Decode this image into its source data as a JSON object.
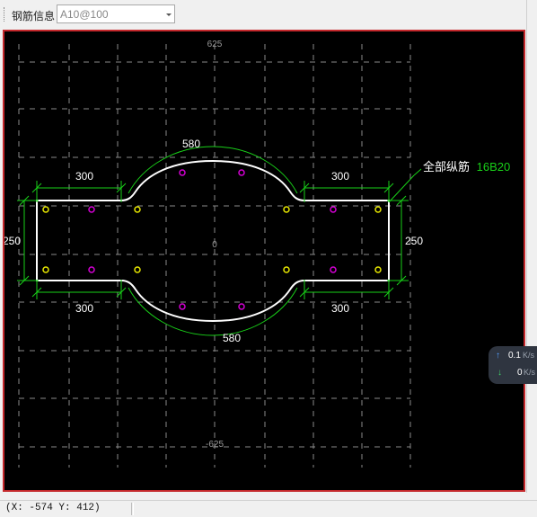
{
  "toolbar": {
    "label": "钢筋信息",
    "stirrup_value": "A10@100"
  },
  "drawing": {
    "dim_top_left": "300",
    "dim_top_right": "300",
    "dim_bottom_left": "300",
    "dim_bottom_right": "300",
    "dim_arc_top": "580",
    "dim_arc_bottom": "580",
    "dim_height_left": "250",
    "dim_height_right": "250",
    "axis_top": "625",
    "axis_bottom": "-625",
    "origin": "0",
    "rebar_label": "全部纵筋",
    "rebar_value": "16B20",
    "colors": {
      "outline": "#ffffff",
      "dimension": "#19d019",
      "rebar_corner": "#e8e800",
      "rebar_side": "#d400d4",
      "grid": "#8a8a8a"
    }
  },
  "network": {
    "upload_value": "0.1",
    "upload_unit": "K/s",
    "download_value": "0",
    "download_unit": "K/s"
  },
  "status": {
    "coordinates": "(X: -574 Y: 412)"
  }
}
